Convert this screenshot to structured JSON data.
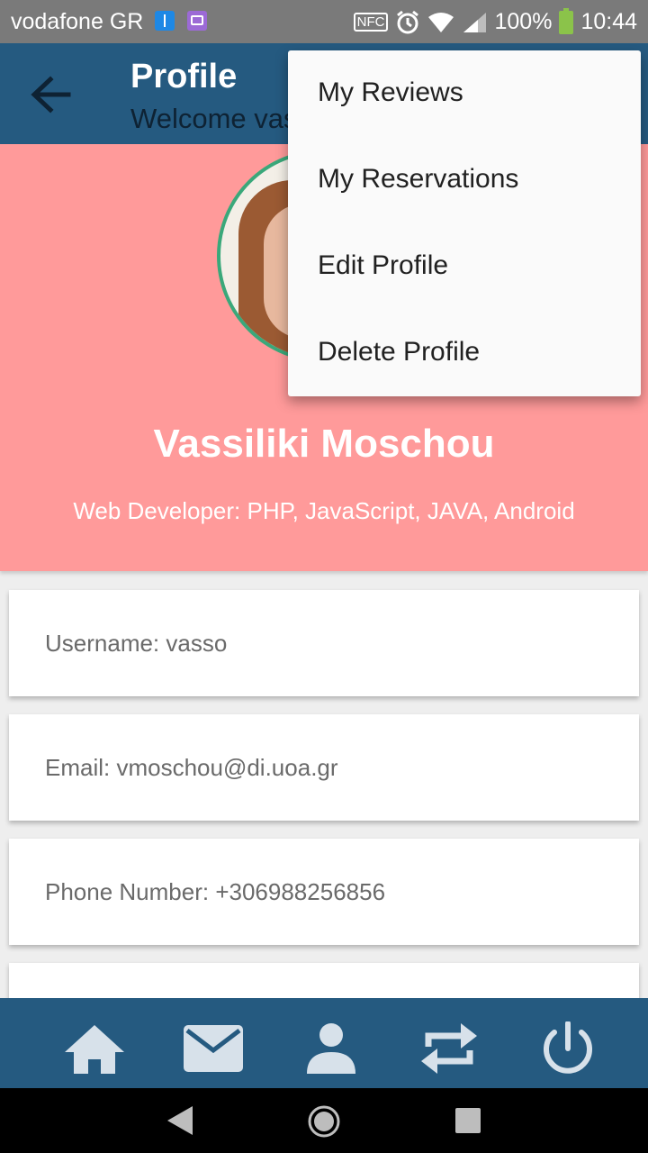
{
  "status_bar": {
    "carrier": "vodafone GR",
    "nfc": "NFC",
    "battery": "100%",
    "time": "10:44"
  },
  "app_bar": {
    "title": "Profile",
    "subtitle": "Welcome vasso"
  },
  "overflow_menu": {
    "items": [
      {
        "label": "My Reviews"
      },
      {
        "label": "My Reservations"
      },
      {
        "label": "Edit Profile"
      },
      {
        "label": "Delete Profile"
      }
    ]
  },
  "profile": {
    "name": "Vassiliki Moschou",
    "role": "Web Developer: PHP, JavaScript, JAVA, Android"
  },
  "cards": {
    "username": "Username: vasso",
    "email": "Email: vmoschou@di.uoa.gr",
    "phone": "Phone Number: +306988256856"
  },
  "bottom_nav": {
    "icons": [
      "home-icon",
      "mail-icon",
      "person-icon",
      "swap-icon",
      "power-icon"
    ]
  },
  "colors": {
    "app_bar": "#255a80",
    "header": "#ff9a9a",
    "menu_bg": "#fafafa"
  }
}
